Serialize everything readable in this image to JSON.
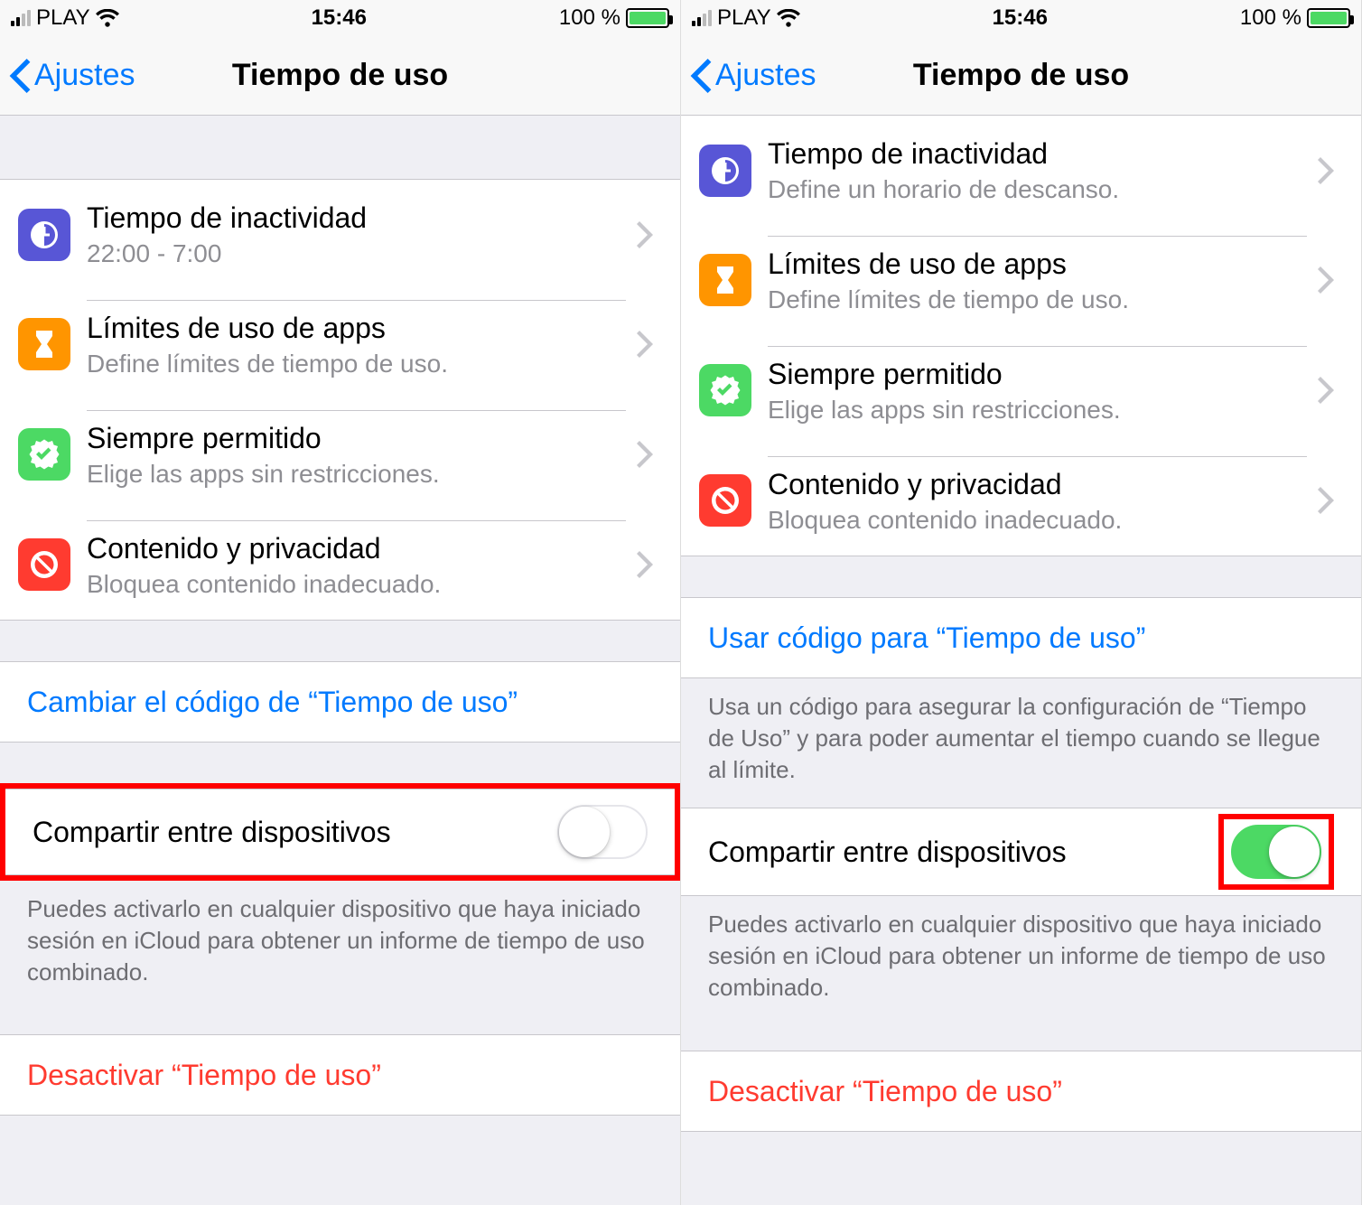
{
  "status": {
    "carrier": "PLAY",
    "time": "15:46",
    "battery_text": "100 %"
  },
  "nav": {
    "back_label": "Ajustes",
    "title": "Tiempo de uso"
  },
  "left": {
    "rows": {
      "downtime": {
        "title": "Tiempo de inactividad",
        "sub": "22:00 - 7:00"
      },
      "applimits": {
        "title": "Límites de uso de apps",
        "sub": "Define límites de tiempo de uso."
      },
      "always": {
        "title": "Siempre permitido",
        "sub": "Elige las apps sin restricciones."
      },
      "content": {
        "title": "Contenido y privacidad",
        "sub": "Bloquea contenido inadecuado."
      }
    },
    "change_code": "Cambiar el código de “Tiempo de uso”",
    "share_label": "Compartir entre dispositivos",
    "share_footer": "Puedes activarlo en cualquier dispositivo que haya iniciado sesión en iCloud para obtener un informe de tiempo de uso combinado.",
    "disable_label": "Desactivar “Tiempo de uso”"
  },
  "right": {
    "rows": {
      "downtime": {
        "title": "Tiempo de inactividad",
        "sub": "Define un horario de descanso."
      },
      "applimits": {
        "title": "Límites de uso de apps",
        "sub": "Define límites de tiempo de uso."
      },
      "always": {
        "title": "Siempre permitido",
        "sub": "Elige las apps sin restricciones."
      },
      "content": {
        "title": "Contenido y privacidad",
        "sub": "Bloquea contenido inadecuado."
      }
    },
    "use_code": "Usar código para “Tiempo de uso”",
    "use_code_footer": "Usa un código para asegurar la configuración de “Tiempo de Uso” y para poder aumentar el tiempo cuando se llegue al límite.",
    "share_label": "Compartir entre dispositivos",
    "share_footer": "Puedes activarlo en cualquier dispositivo que haya iniciado sesión en iCloud para obtener un informe de tiempo de uso combinado.",
    "disable_label": "Desactivar “Tiempo de uso”"
  }
}
